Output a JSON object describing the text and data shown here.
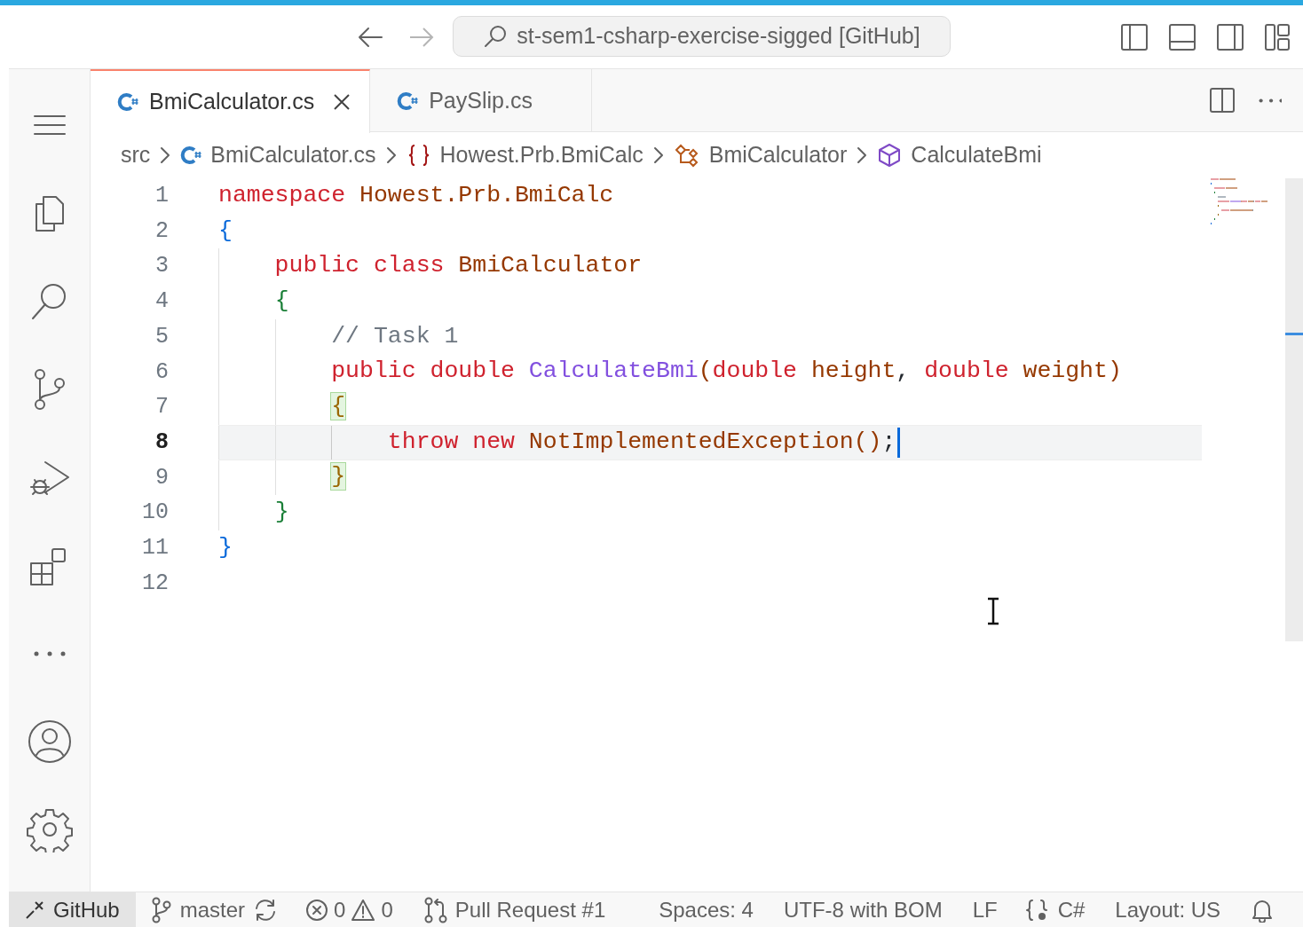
{
  "title_bar": {
    "search": "st-sem1-csharp-exercise-sigged [GitHub]",
    "forward_disabled": true
  },
  "tabs": [
    {
      "label": "BmiCalculator.cs",
      "selected": true
    },
    {
      "label": "PaySlip.cs",
      "selected": false
    }
  ],
  "breadcrumbs": [
    {
      "label": "src",
      "kind": "folder"
    },
    {
      "label": "BmiCalculator.cs",
      "kind": "file"
    },
    {
      "label": "Howest.Prb.BmiCalc",
      "kind": "namespace"
    },
    {
      "label": "BmiCalculator",
      "kind": "class"
    },
    {
      "label": "CalculateBmi",
      "kind": "method"
    }
  ],
  "editor": {
    "lines": [
      {
        "number": "1",
        "current": false,
        "tokens": [
          {
            "text": "namespace",
            "kind": "keyword"
          },
          {
            "text": " Howest.Prb.BmiCalc",
            "kind": "type"
          }
        ]
      },
      {
        "number": "2",
        "current": false,
        "tokens": [
          {
            "text": "{",
            "kind": "brace",
            "color": "#0969da",
            "matched": false
          }
        ]
      },
      {
        "number": "3",
        "current": false,
        "tokens": [
          {
            "text": "    public class",
            "kind": "keyword"
          },
          {
            "text": " BmiCalculator",
            "kind": "type"
          }
        ]
      },
      {
        "number": "4",
        "current": false,
        "tokens": [
          {
            "text": "    {",
            "kind": "brace",
            "color": "#1a7f37",
            "matched": false
          }
        ]
      },
      {
        "number": "5",
        "current": false,
        "tokens": [
          {
            "text": "        // Task 1",
            "kind": "comment"
          }
        ]
      },
      {
        "number": "6",
        "current": false,
        "tokens": [
          {
            "text": "        public double",
            "kind": "keyword"
          },
          {
            "text": " CalculateBmi",
            "kind": "function"
          },
          {
            "text": "(",
            "kind": "punct"
          },
          {
            "text": "double",
            "kind": "keyword"
          },
          {
            "text": " height",
            "kind": "type"
          },
          {
            "text": ",",
            "kind": "plain"
          },
          {
            "text": " double",
            "kind": "keyword"
          },
          {
            "text": " weight",
            "kind": "type"
          },
          {
            "text": ")",
            "kind": "punct"
          }
        ]
      },
      {
        "number": "7",
        "current": false,
        "tokens": [
          {
            "text": "        {",
            "kind": "brace",
            "color": "#9a6700",
            "matched": true
          }
        ]
      },
      {
        "number": "8",
        "current": true,
        "tokens": [
          {
            "text": "            throw new",
            "kind": "keyword"
          },
          {
            "text": " NotImplementedException",
            "kind": "type"
          },
          {
            "text": "()",
            "kind": "punct"
          },
          {
            "text": ";",
            "kind": "plain"
          }
        ]
      },
      {
        "number": "9",
        "current": false,
        "tokens": [
          {
            "text": "        }",
            "kind": "brace",
            "color": "#9a6700",
            "matched": true
          }
        ]
      },
      {
        "number": "10",
        "current": false,
        "tokens": [
          {
            "text": "    }",
            "kind": "brace",
            "color": "#1a7f37",
            "matched": false
          }
        ]
      },
      {
        "number": "11",
        "current": false,
        "tokens": [
          {
            "text": "}",
            "kind": "brace",
            "color": "#0969da",
            "matched": false
          }
        ]
      },
      {
        "number": "12",
        "current": false
      }
    ]
  },
  "status_bar": [
    {
      "kind": "remote",
      "text": "GitHub"
    },
    {
      "kind": "branch",
      "text": "master"
    },
    {
      "kind": "problems",
      "text": "0",
      "text2": "0"
    },
    {
      "kind": "pull",
      "text": "Pull Request #1"
    },
    {
      "kind": "plain",
      "text": "Spaces: 4"
    },
    {
      "kind": "plain",
      "text": "UTF-8 with BOM"
    },
    {
      "kind": "plain",
      "text": "LF"
    },
    {
      "kind": "language",
      "text": "C#"
    },
    {
      "kind": "plain",
      "text": "Layout: US"
    },
    {
      "kind": "bell"
    }
  ]
}
